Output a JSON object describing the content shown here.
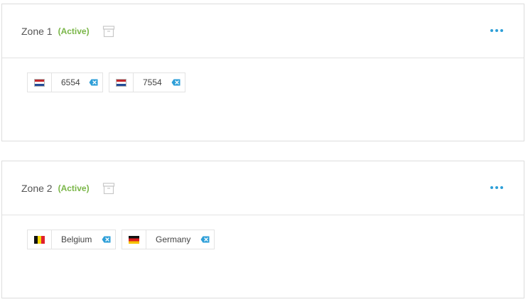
{
  "zones": [
    {
      "title": "Zone 1",
      "status": "(Active)",
      "archive_icon": "archive-box-icon",
      "more_icon": "more-horizontal-icon",
      "tags": [
        {
          "label": "6554",
          "flag": "netherlands-flag-icon"
        },
        {
          "label": "7554",
          "flag": "netherlands-flag-icon"
        }
      ]
    },
    {
      "title": "Zone 2",
      "status": "(Active)",
      "archive_icon": "archive-box-icon",
      "more_icon": "more-horizontal-icon",
      "tags": [
        {
          "label": "Belgium",
          "flag": "belgium-flag-icon"
        },
        {
          "label": "Germany",
          "flag": "germany-flag-icon"
        }
      ]
    }
  ],
  "colors": {
    "status": "#7ab648",
    "accent": "#2e9fd8",
    "border": "#dddddd"
  }
}
